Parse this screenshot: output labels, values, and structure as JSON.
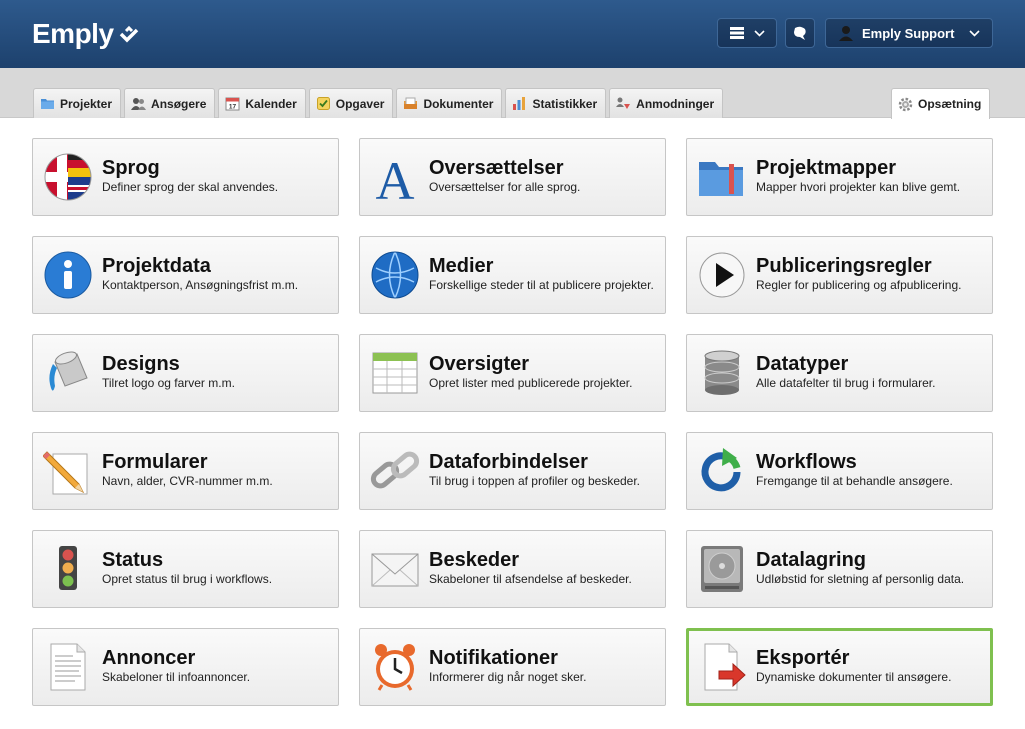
{
  "header": {
    "logo": "Emply",
    "user_name": "Emply Support"
  },
  "tabs": [
    {
      "label": "Projekter",
      "icon": "folder-icon"
    },
    {
      "label": "Ansøgere",
      "icon": "users-icon"
    },
    {
      "label": "Kalender",
      "icon": "calendar-icon"
    },
    {
      "label": "Opgaver",
      "icon": "tasks-icon"
    },
    {
      "label": "Dokumenter",
      "icon": "documents-icon"
    },
    {
      "label": "Statistikker",
      "icon": "statistics-icon"
    },
    {
      "label": "Anmodninger",
      "icon": "requests-icon"
    }
  ],
  "active_tab": {
    "label": "Opsætning",
    "icon": "gear-icon"
  },
  "cards": [
    {
      "title": "Sprog",
      "desc": "Definer sprog der skal anvendes.",
      "icon": "flag-icon"
    },
    {
      "title": "Oversættelser",
      "desc": "Oversættelser for alle sprog.",
      "icon": "letter-a-icon"
    },
    {
      "title": "Projektmapper",
      "desc": "Mapper hvori projekter kan blive gemt.",
      "icon": "folder-icon"
    },
    {
      "title": "Projektdata",
      "desc": "Kontaktperson, Ansøgningsfrist m.m.",
      "icon": "info-icon"
    },
    {
      "title": "Medier",
      "desc": "Forskellige steder til at publicere projekter.",
      "icon": "globe-icon"
    },
    {
      "title": "Publiceringsregler",
      "desc": "Regler for publicering og afpublicering.",
      "icon": "play-icon"
    },
    {
      "title": "Designs",
      "desc": "Tilret logo og farver m.m.",
      "icon": "paint-bucket-icon"
    },
    {
      "title": "Oversigter",
      "desc": "Opret lister med publicerede projekter.",
      "icon": "table-icon"
    },
    {
      "title": "Datatyper",
      "desc": "Alle datafelter til brug i formularer.",
      "icon": "database-icon"
    },
    {
      "title": "Formularer",
      "desc": "Navn, alder, CVR-nummer m.m.",
      "icon": "pencil-icon"
    },
    {
      "title": "Dataforbindelser",
      "desc": "Til brug i toppen af profiler og beskeder.",
      "icon": "chain-link-icon"
    },
    {
      "title": "Workflows",
      "desc": "Fremgange til at behandle ansøgere.",
      "icon": "refresh-icon"
    },
    {
      "title": "Status",
      "desc": "Opret status til brug i workflows.",
      "icon": "traffic-light-icon"
    },
    {
      "title": "Beskeder",
      "desc": "Skabeloner til afsendelse af beskeder.",
      "icon": "envelope-icon"
    },
    {
      "title": "Datalagring",
      "desc": "Udløbstid for sletning af personlig data.",
      "icon": "hard-drive-icon"
    },
    {
      "title": "Annoncer",
      "desc": "Skabeloner til infoannoncer.",
      "icon": "document-icon"
    },
    {
      "title": "Notifikationer",
      "desc": "Informerer dig når noget sker.",
      "icon": "alarm-clock-icon"
    },
    {
      "title": "Eksportér",
      "desc": "Dynamiske dokumenter til ansøgere.",
      "icon": "export-icon"
    }
  ],
  "selected_card_index": 17,
  "colors": {
    "header": "#2e5a8d",
    "selected_border": "#7fc04f"
  }
}
